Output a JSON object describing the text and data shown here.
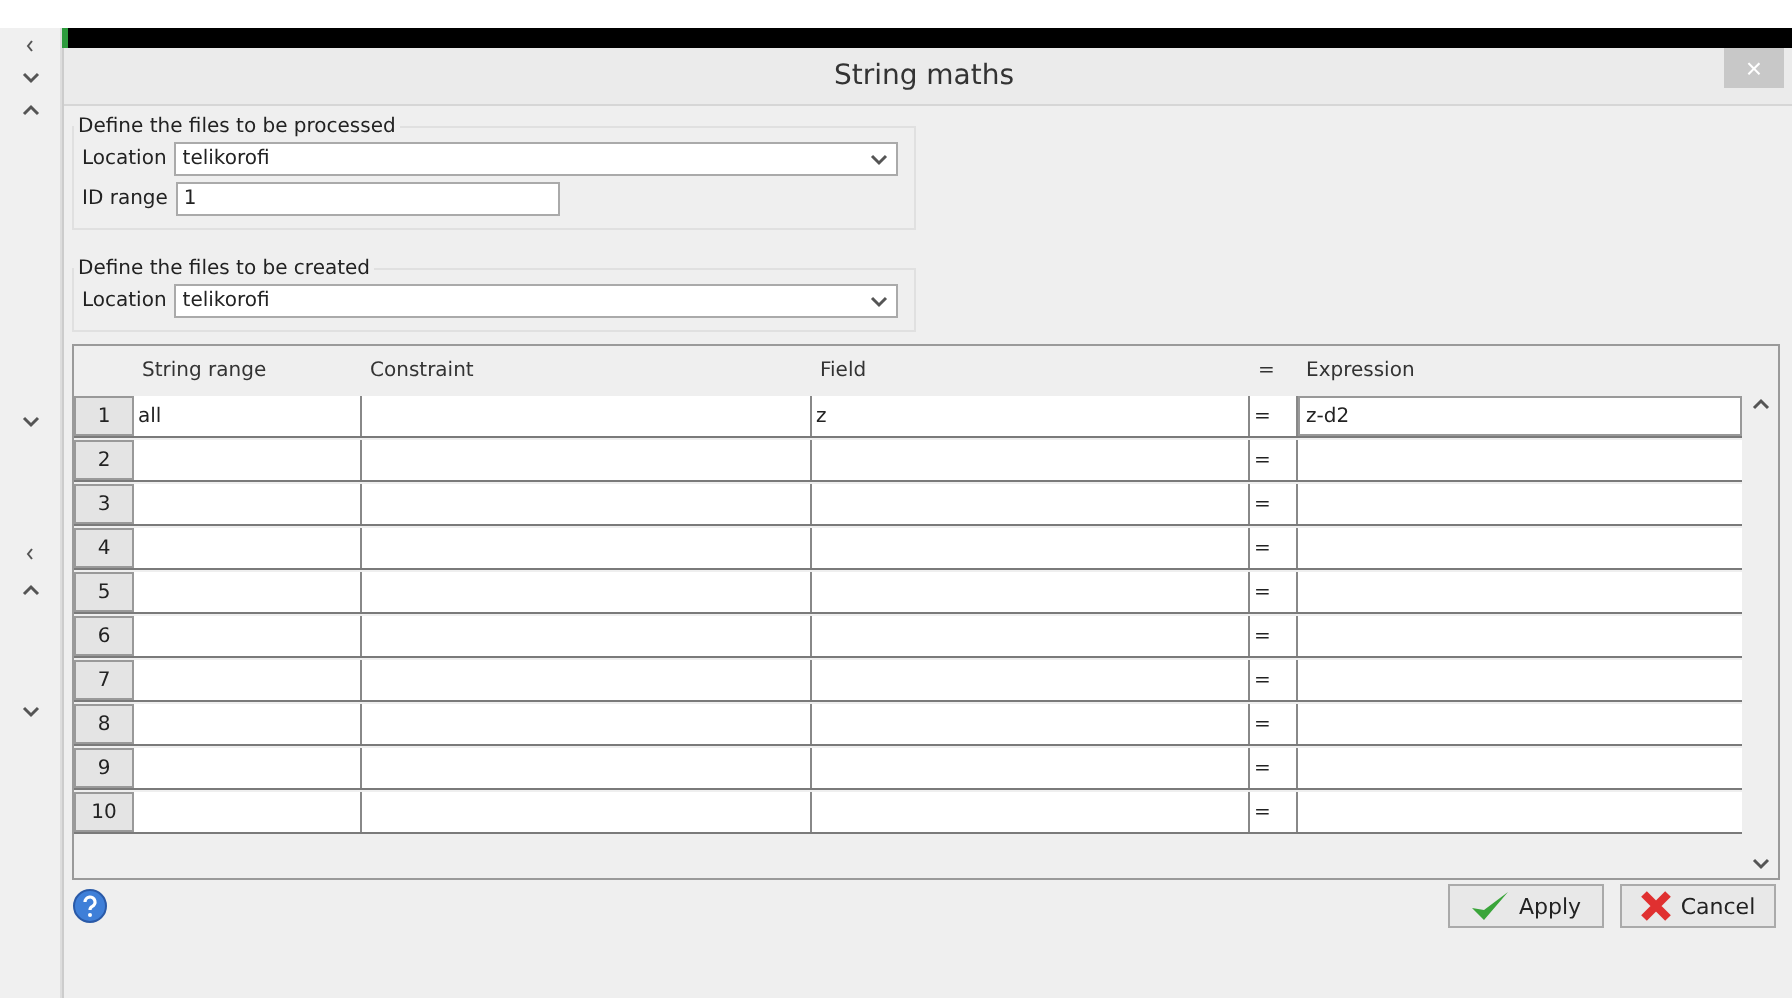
{
  "window": {
    "title": "String maths",
    "close": "×"
  },
  "processed": {
    "legend": "Define the files to be processed",
    "location_label": "Location",
    "location_value": "telikorofi",
    "id_label": "ID range",
    "id_value": "1"
  },
  "created": {
    "legend": "Define the files to be created",
    "location_label": "Location",
    "location_value": "telikorofi"
  },
  "table": {
    "columns": [
      "String range",
      "Constraint",
      "Field",
      "=",
      "Expression"
    ],
    "rows": [
      {
        "number": "1",
        "string_range": "all",
        "constraint": "",
        "field": "z",
        "equals": "=",
        "expression": "z-d2"
      },
      {
        "number": "2",
        "string_range": "",
        "constraint": "",
        "field": "",
        "equals": "=",
        "expression": ""
      },
      {
        "number": "3",
        "string_range": "",
        "constraint": "",
        "field": "",
        "equals": "=",
        "expression": ""
      },
      {
        "number": "4",
        "string_range": "",
        "constraint": "",
        "field": "",
        "equals": "=",
        "expression": ""
      },
      {
        "number": "5",
        "string_range": "",
        "constraint": "",
        "field": "",
        "equals": "=",
        "expression": ""
      },
      {
        "number": "6",
        "string_range": "",
        "constraint": "",
        "field": "",
        "equals": "=",
        "expression": ""
      },
      {
        "number": "7",
        "string_range": "",
        "constraint": "",
        "field": "",
        "equals": "=",
        "expression": ""
      },
      {
        "number": "8",
        "string_range": "",
        "constraint": "",
        "field": "",
        "equals": "=",
        "expression": ""
      },
      {
        "number": "9",
        "string_range": "",
        "constraint": "",
        "field": "",
        "equals": "=",
        "expression": ""
      },
      {
        "number": "10",
        "string_range": "",
        "constraint": "",
        "field": "",
        "equals": "=",
        "expression": ""
      }
    ]
  },
  "buttons": [
    {
      "kind": "apply",
      "label": "Apply"
    },
    {
      "kind": "cancel",
      "label": "Cancel"
    }
  ]
}
